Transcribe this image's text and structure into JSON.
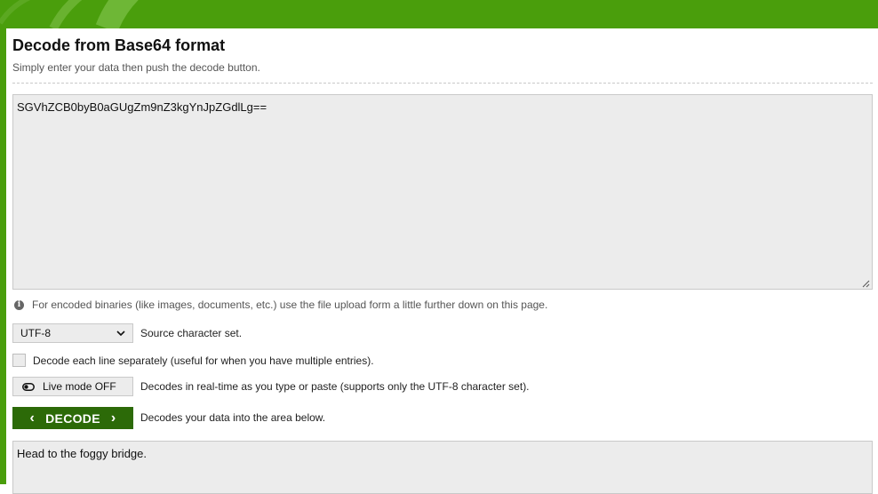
{
  "header": {
    "title": "Decode from Base64 format",
    "subtitle": "Simply enter your data then push the decode button."
  },
  "input": {
    "value": "SGVhZCB0byB0aGUgZm9nZ3kgYnJpZGdlLg=="
  },
  "info": {
    "icon": "info-icon",
    "text": "For encoded binaries (like images, documents, etc.) use the file upload form a little further down on this page."
  },
  "charset": {
    "selected": "UTF-8",
    "label": "Source character set."
  },
  "each_line": {
    "checked": false,
    "label": "Decode each line separately (useful for when you have multiple entries)."
  },
  "live_mode": {
    "label": "Live mode OFF",
    "description": "Decodes in real-time as you type or paste (supports only the UTF-8 character set)."
  },
  "decode": {
    "label": "DECODE",
    "description": "Decodes your data into the area below."
  },
  "output": {
    "value": "Head to the foggy bridge."
  },
  "colors": {
    "brand_green": "#4a9e0c",
    "button_green": "#2c6a08"
  }
}
